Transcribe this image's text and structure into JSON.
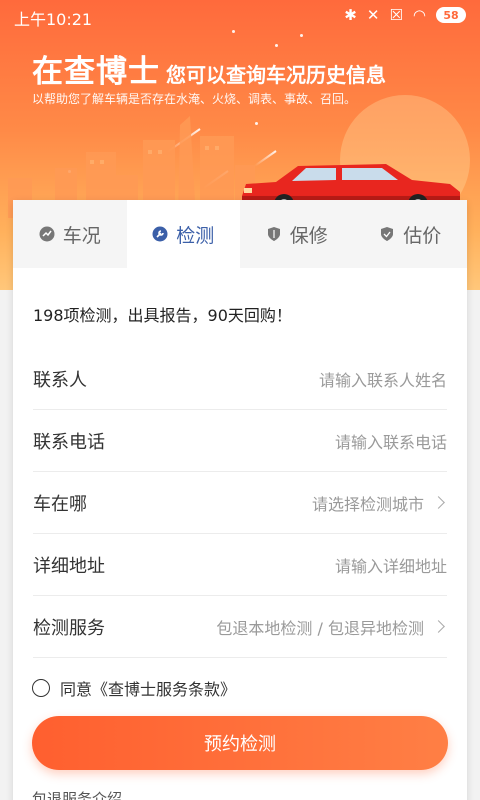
{
  "status_bar": {
    "time": "上午10:21",
    "battery": "58",
    "icons": [
      "bluetooth-icon",
      "mute-icon",
      "sim-off-icon",
      "wifi-icon",
      "battery-icon"
    ]
  },
  "hero": {
    "brand": "在查博士",
    "tagline": "您可以查询车况历史信息",
    "subtitle": "以帮助您了解车辆是否存在水淹、火烧、调表、事故、召回。"
  },
  "tabs": [
    {
      "label": "车况",
      "icon": "chart-icon",
      "active": false
    },
    {
      "label": "检测",
      "icon": "wrench-icon",
      "active": true
    },
    {
      "label": "保修",
      "icon": "shield-icon",
      "active": false
    },
    {
      "label": "估价",
      "icon": "shield-check-icon",
      "active": false
    }
  ],
  "form": {
    "intro": "198项检测，出具报告，90天回购！",
    "rows": [
      {
        "label": "联系人",
        "placeholder": "请输入联系人姓名",
        "chevron": false
      },
      {
        "label": "联系电话",
        "placeholder": "请输入联系电话",
        "chevron": false
      },
      {
        "label": "车在哪",
        "placeholder": "请选择检测城市",
        "chevron": true
      },
      {
        "label": "详细地址",
        "placeholder": "请输入详细地址",
        "chevron": false
      },
      {
        "label": "检测服务",
        "placeholder": "包退本地检测 / 包退异地检测",
        "chevron": true
      }
    ],
    "agreement": "同意《查博士服务条款》",
    "submit": "预约检测",
    "footer_link": "包退服务介绍"
  },
  "colors": {
    "accent": "#ff6a3c",
    "active_tab": "#3b5fa8"
  }
}
